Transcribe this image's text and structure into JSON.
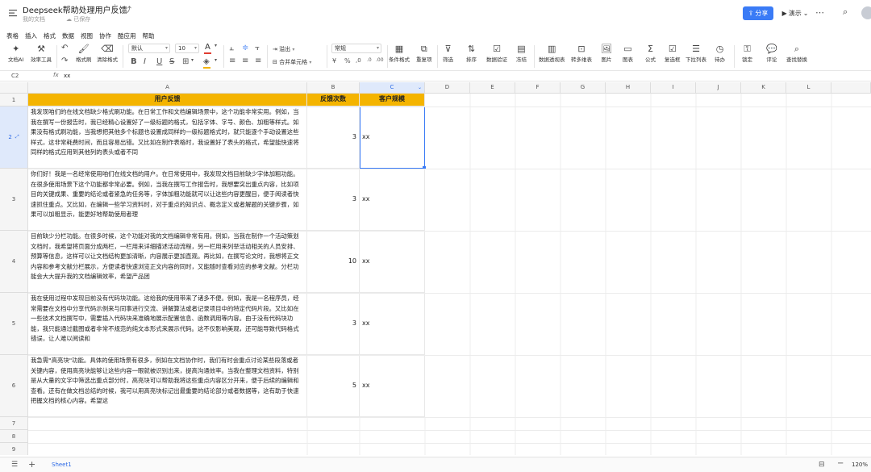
{
  "header": {
    "doc_title": "Deepseek帮助处理用户反馈",
    "location": "我的文档",
    "saved_status": "已保存",
    "share_label": "分享",
    "present_label": "演示"
  },
  "menu": [
    "表格",
    "插入",
    "格式",
    "数据",
    "视图",
    "协作",
    "酷应用",
    "帮助"
  ],
  "toolbar": {
    "doc_ai": "文档AI",
    "efficiency": "效率工具",
    "format_brush": "格式刷",
    "clear_format": "清除格式",
    "font": "默认",
    "font_size": "10",
    "overflow": "溢出",
    "merge": "合并单元格",
    "number_format": "常规",
    "conditional_format": "条件格式",
    "duplicates": "重复项",
    "filter": "筛选",
    "sort": "排序",
    "validation": "数据验证",
    "freeze": "冻结",
    "pivot": "数据透视表",
    "convert": "转多维表",
    "image": "图片",
    "chart": "图表",
    "formula": "公式",
    "checkbox": "复选框",
    "dropdown": "下拉列表",
    "todo": "待办",
    "lock": "锁定",
    "comment": "评论",
    "find_replace": "查找替换",
    "accent_color": "#3a7bf6",
    "font_color_swatch": "#e03c31",
    "fill_color_swatch": "#f4b400"
  },
  "formula_bar": {
    "cell_ref": "C2",
    "fx": "fx",
    "value": "xx"
  },
  "columns": [
    "A",
    "B",
    "C",
    "D",
    "E",
    "F",
    "G",
    "H",
    "I",
    "J",
    "K",
    "L"
  ],
  "rows": [
    "1",
    "2",
    "3",
    "4",
    "5",
    "6",
    "7",
    "8",
    "9"
  ],
  "table": {
    "headers": [
      "用户反馈",
      "反馈次数",
      "客户规模"
    ],
    "header_fill": "#f4b400",
    "rows": [
      {
        "feedback": "我发现咱们的在线文档缺少格式刷功能。在日常工作和文档编辑场景中，这个功能非常实用。例如，当我在撰写一份报告时，我已经精心设置好了一级标题的格式，包括字体、字号、颜色、加粗等样式。如果没有格式刷功能，当我想把其他多个标题也设置成同样的一级标题格式时，就只能逐个手动设置这些样式，这非常耗费时间，而且容易出错。又比如在制作表格时，我设置好了表头的格式，希望能快速将同样的格式应用到其他列的表头或者不同",
        "count": "3",
        "scale": "xx"
      },
      {
        "feedback": "你们好！我是一名经常使用咱们在线文档的用户。在日常使用中，我发现文档目前缺少字体加粗功能。在很多使用场景下这个功能都非常必要。例如，当我在撰写工作报告时，我想要突出重点内容，比如项目的关键成果、重要的结论或者紧急的任务等，字体加粗功能就可以让这些内容更醒目，便于阅读者快速抓住重点。又比如，在编辑一些学习资料时，对于重点的知识点、概念定义或者解题的关键步骤，如果可以加粗显示，能更好地帮助使用者理",
        "count": "3",
        "scale": "xx"
      },
      {
        "feedback": "目前缺少分栏功能。在很多时候，这个功能对我的文档编辑非常有用。例如，当我在制作一个活动策划文档时，我希望将页面分成两栏，一栏用来详细描述活动流程，另一栏用来列举活动相关的人员安排、预算等信息，这样可以让文档结构更加清晰，内容展示更加直观。再比如，在撰写论文时，我想将正文内容和参考文献分栏展示，方便读者快速浏览正文内容的同时，又能随时查看对应的参考文献。分栏功能会大大提升我的文档编辑效率，希望产品团",
        "count": "10",
        "scale": "xx"
      },
      {
        "feedback": "我在使用过程中发现目前没有代码块功能。这给我的使用带来了诸多不便。例如，我是一名程序员，经常需要在文档中分享代码示例来与同事进行交流、讲解算法或者记录项目中的特定代码片段。又比如在一些技术文档撰写中，需要插入代码块来准确地展示配置信息、函数调用等内容。由于没有代码块功能，我只能通过截图或者非常不规范的纯文本形式来展示代码。这不仅影响美观，还可能导致代码格式错误，让人难以阅读和",
        "count": "3",
        "scale": "xx"
      },
      {
        "feedback": "我急需\"高亮块\"功能。具体的使用场景有很多，例如在文档协作时，我们有时会重点讨论某些段落或者关键内容，使用高亮块能够让这些内容一眼就被识别出来，提高沟通效率。当我在整理文档资料，特别是从大量的文字中筛选出重点部分时，高亮块可以帮助我将这些重点内容区分开来，便于后续的编辑和查看。还有在做文档总结的时候，我可以用高亮块标记出最重要的结论部分或者数据等，这有助于快速把握文档的核心内容。希望这",
        "count": "5",
        "scale": "xx"
      }
    ]
  },
  "sheet_tab": "Sheet1",
  "zoom": "120%"
}
